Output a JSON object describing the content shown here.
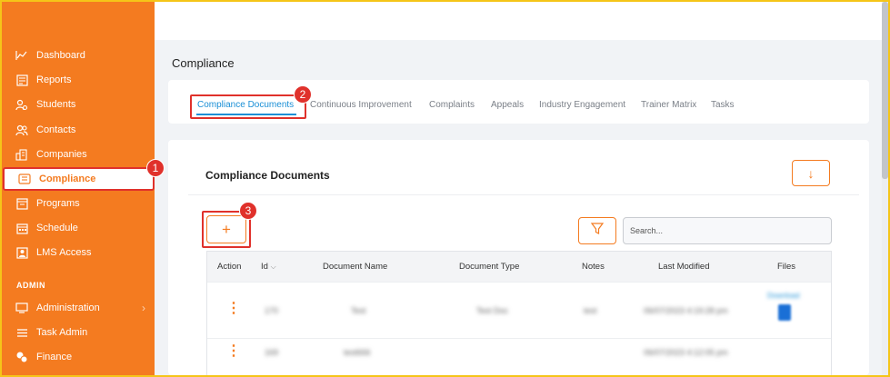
{
  "sidebar": {
    "items": [
      {
        "label": "Dashboard",
        "icon": "chart-line-icon"
      },
      {
        "label": "Reports",
        "icon": "report-icon"
      },
      {
        "label": "Students",
        "icon": "students-icon"
      },
      {
        "label": "Contacts",
        "icon": "contacts-icon"
      },
      {
        "label": "Companies",
        "icon": "building-icon"
      },
      {
        "label": "Compliance",
        "icon": "compliance-icon",
        "active": true
      },
      {
        "label": "Programs",
        "icon": "programs-icon"
      },
      {
        "label": "Schedule",
        "icon": "calendar-icon"
      },
      {
        "label": "LMS Access",
        "icon": "lms-icon"
      }
    ],
    "section_admin": "ADMIN",
    "admin_items": [
      {
        "label": "Administration",
        "icon": "admin-icon",
        "has_submenu": true
      },
      {
        "label": "Task Admin",
        "icon": "list-icon"
      },
      {
        "label": "Finance",
        "icon": "finance-icon"
      }
    ]
  },
  "page": {
    "title": "Compliance"
  },
  "tabs": [
    {
      "label": "Compliance Documents",
      "active": true
    },
    {
      "label": "Continuous Improvement"
    },
    {
      "label": "Complaints"
    },
    {
      "label": "Appeals"
    },
    {
      "label": "Industry Engagement"
    },
    {
      "label": "Trainer Matrix"
    },
    {
      "label": "Tasks"
    }
  ],
  "card": {
    "title": "Compliance Documents",
    "download_icon": "↓",
    "add_icon": "+",
    "search_placeholder": "Search..."
  },
  "table": {
    "headers": [
      "Action",
      "Id",
      "Document Name",
      "Document Type",
      "Notes",
      "Last Modified",
      "Files"
    ],
    "id_sort_icon": "⌵",
    "rows": [
      {
        "id": "170",
        "name": "Test",
        "type": "Test Doc",
        "notes": "test",
        "modified": "06/07/2023 4:19:28 pm",
        "file": "Download"
      },
      {
        "id": "169",
        "name": "test666",
        "type": "",
        "notes": "",
        "modified": "06/07/2023 4:12:05 pm",
        "file": ""
      }
    ]
  },
  "annotations": [
    "1",
    "2",
    "3"
  ],
  "colors": {
    "brand": "#f47b20",
    "highlight": "#e0312b",
    "link": "#1a8fd6",
    "frame": "#f5c518"
  }
}
